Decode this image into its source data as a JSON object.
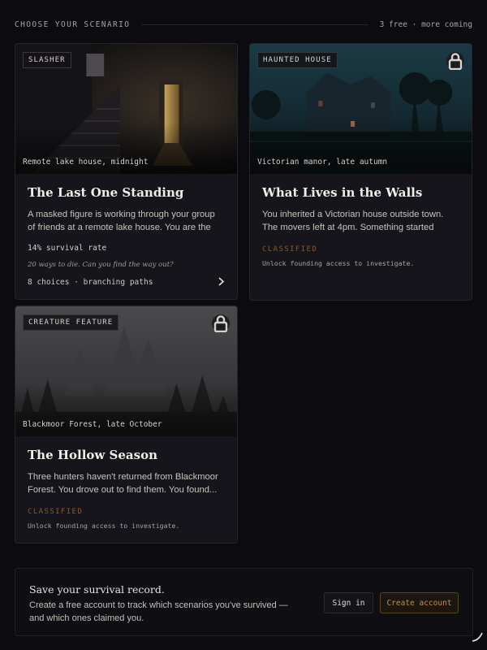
{
  "header": {
    "left_label": "CHOOSE YOUR SCENARIO",
    "right_label": "3 free · more coming"
  },
  "scenarios": [
    {
      "tag": "SLASHER",
      "caption": "Remote lake house, midnight",
      "title": "The Last One Standing",
      "description": "A masked figure is working through your group of friends at a remote lake house. You are the last o...",
      "survival_rate": "14% survival rate",
      "quip": "20 ways to die. Can you find the way out?",
      "meta": "8 choices · branching paths",
      "locked": false,
      "icon": "chevron-right-icon"
    },
    {
      "tag": "HAUNTED HOUSE",
      "caption": "Victorian manor, late autumn",
      "title": "What Lives in the Walls",
      "description": "You inherited a Victorian house outside town. The movers left at 4pm. Something started moving at...",
      "status": "CLASSIFIED",
      "unlock_text": "Unlock founding access to investigate.",
      "locked": true,
      "icon": "lock-icon"
    },
    {
      "tag": "CREATURE FEATURE",
      "caption": "Blackmoor Forest, late October",
      "title": "The Hollow Season",
      "description": "Three hunters haven't returned from Blackmoor Forest. You drove out to find them. You found...",
      "status": "CLASSIFIED",
      "unlock_text": "Unlock founding access to investigate.",
      "locked": true,
      "icon": "lock-icon"
    }
  ],
  "banner": {
    "title": "Save your survival record.",
    "description": "Create a free account to track which scenarios you've survived — and which ones claimed you.",
    "signin_label": "Sign in",
    "create_label": "Create account"
  },
  "colors": {
    "background": "#0c0b0f",
    "card": "#16151b",
    "accent": "#c38f4f",
    "classified": "#8a5a2a"
  }
}
